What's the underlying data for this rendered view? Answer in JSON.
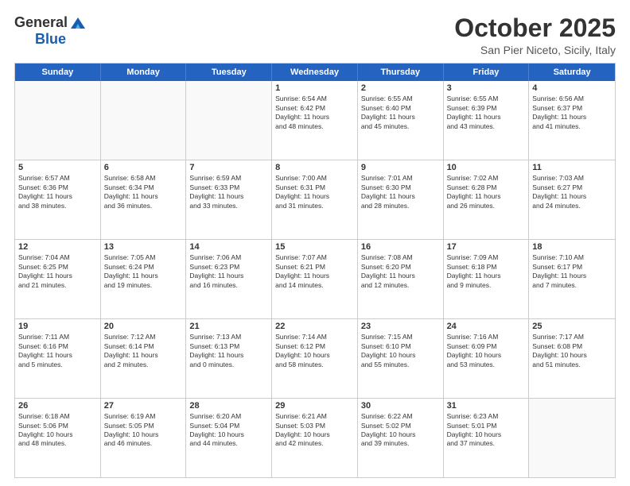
{
  "logo": {
    "general": "General",
    "blue": "Blue"
  },
  "title": "October 2025",
  "location": "San Pier Niceto, Sicily, Italy",
  "header_days": [
    "Sunday",
    "Monday",
    "Tuesday",
    "Wednesday",
    "Thursday",
    "Friday",
    "Saturday"
  ],
  "weeks": [
    [
      {
        "day": "",
        "text": ""
      },
      {
        "day": "",
        "text": ""
      },
      {
        "day": "",
        "text": ""
      },
      {
        "day": "1",
        "text": "Sunrise: 6:54 AM\nSunset: 6:42 PM\nDaylight: 11 hours\nand 48 minutes."
      },
      {
        "day": "2",
        "text": "Sunrise: 6:55 AM\nSunset: 6:40 PM\nDaylight: 11 hours\nand 45 minutes."
      },
      {
        "day": "3",
        "text": "Sunrise: 6:55 AM\nSunset: 6:39 PM\nDaylight: 11 hours\nand 43 minutes."
      },
      {
        "day": "4",
        "text": "Sunrise: 6:56 AM\nSunset: 6:37 PM\nDaylight: 11 hours\nand 41 minutes."
      }
    ],
    [
      {
        "day": "5",
        "text": "Sunrise: 6:57 AM\nSunset: 6:36 PM\nDaylight: 11 hours\nand 38 minutes."
      },
      {
        "day": "6",
        "text": "Sunrise: 6:58 AM\nSunset: 6:34 PM\nDaylight: 11 hours\nand 36 minutes."
      },
      {
        "day": "7",
        "text": "Sunrise: 6:59 AM\nSunset: 6:33 PM\nDaylight: 11 hours\nand 33 minutes."
      },
      {
        "day": "8",
        "text": "Sunrise: 7:00 AM\nSunset: 6:31 PM\nDaylight: 11 hours\nand 31 minutes."
      },
      {
        "day": "9",
        "text": "Sunrise: 7:01 AM\nSunset: 6:30 PM\nDaylight: 11 hours\nand 28 minutes."
      },
      {
        "day": "10",
        "text": "Sunrise: 7:02 AM\nSunset: 6:28 PM\nDaylight: 11 hours\nand 26 minutes."
      },
      {
        "day": "11",
        "text": "Sunrise: 7:03 AM\nSunset: 6:27 PM\nDaylight: 11 hours\nand 24 minutes."
      }
    ],
    [
      {
        "day": "12",
        "text": "Sunrise: 7:04 AM\nSunset: 6:25 PM\nDaylight: 11 hours\nand 21 minutes."
      },
      {
        "day": "13",
        "text": "Sunrise: 7:05 AM\nSunset: 6:24 PM\nDaylight: 11 hours\nand 19 minutes."
      },
      {
        "day": "14",
        "text": "Sunrise: 7:06 AM\nSunset: 6:23 PM\nDaylight: 11 hours\nand 16 minutes."
      },
      {
        "day": "15",
        "text": "Sunrise: 7:07 AM\nSunset: 6:21 PM\nDaylight: 11 hours\nand 14 minutes."
      },
      {
        "day": "16",
        "text": "Sunrise: 7:08 AM\nSunset: 6:20 PM\nDaylight: 11 hours\nand 12 minutes."
      },
      {
        "day": "17",
        "text": "Sunrise: 7:09 AM\nSunset: 6:18 PM\nDaylight: 11 hours\nand 9 minutes."
      },
      {
        "day": "18",
        "text": "Sunrise: 7:10 AM\nSunset: 6:17 PM\nDaylight: 11 hours\nand 7 minutes."
      }
    ],
    [
      {
        "day": "19",
        "text": "Sunrise: 7:11 AM\nSunset: 6:16 PM\nDaylight: 11 hours\nand 5 minutes."
      },
      {
        "day": "20",
        "text": "Sunrise: 7:12 AM\nSunset: 6:14 PM\nDaylight: 11 hours\nand 2 minutes."
      },
      {
        "day": "21",
        "text": "Sunrise: 7:13 AM\nSunset: 6:13 PM\nDaylight: 11 hours\nand 0 minutes."
      },
      {
        "day": "22",
        "text": "Sunrise: 7:14 AM\nSunset: 6:12 PM\nDaylight: 10 hours\nand 58 minutes."
      },
      {
        "day": "23",
        "text": "Sunrise: 7:15 AM\nSunset: 6:10 PM\nDaylight: 10 hours\nand 55 minutes."
      },
      {
        "day": "24",
        "text": "Sunrise: 7:16 AM\nSunset: 6:09 PM\nDaylight: 10 hours\nand 53 minutes."
      },
      {
        "day": "25",
        "text": "Sunrise: 7:17 AM\nSunset: 6:08 PM\nDaylight: 10 hours\nand 51 minutes."
      }
    ],
    [
      {
        "day": "26",
        "text": "Sunrise: 6:18 AM\nSunset: 5:06 PM\nDaylight: 10 hours\nand 48 minutes."
      },
      {
        "day": "27",
        "text": "Sunrise: 6:19 AM\nSunset: 5:05 PM\nDaylight: 10 hours\nand 46 minutes."
      },
      {
        "day": "28",
        "text": "Sunrise: 6:20 AM\nSunset: 5:04 PM\nDaylight: 10 hours\nand 44 minutes."
      },
      {
        "day": "29",
        "text": "Sunrise: 6:21 AM\nSunset: 5:03 PM\nDaylight: 10 hours\nand 42 minutes."
      },
      {
        "day": "30",
        "text": "Sunrise: 6:22 AM\nSunset: 5:02 PM\nDaylight: 10 hours\nand 39 minutes."
      },
      {
        "day": "31",
        "text": "Sunrise: 6:23 AM\nSunset: 5:01 PM\nDaylight: 10 hours\nand 37 minutes."
      },
      {
        "day": "",
        "text": ""
      }
    ]
  ]
}
